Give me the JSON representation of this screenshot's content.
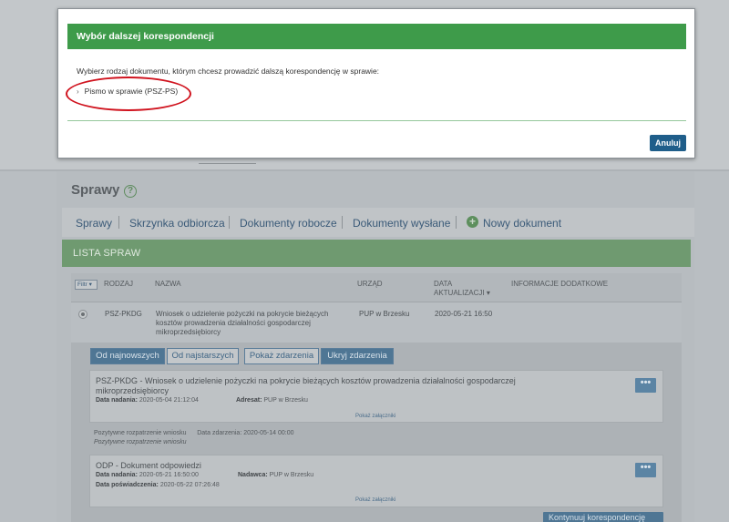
{
  "page": {
    "title": "Sprawy"
  },
  "nav": {
    "items": [
      "Sprawy",
      "Skrzynka odbiorcza",
      "Dokumenty robocze",
      "Dokumenty wysłane"
    ],
    "new_document": "Nowy dokument"
  },
  "lista": {
    "header": "LISTA SPRAW",
    "filter_label": "Filtr",
    "columns": {
      "rodzaj": "RODZAJ",
      "nazwa": "NAZWA",
      "urzad": "URZĄD",
      "data_line1": "DATA",
      "data_line2": "AKTUALIZACJI",
      "info": "INFORMACJE DODATKOWE"
    },
    "row": {
      "rodzaj": "PSZ-PKDG",
      "nazwa": "Wniosek o udzielenie pożyczki na pokrycie bieżących kosztów prowadzenia działalności gospodarczej mikroprzedsiębiorcy",
      "urzad": "PUP w Brzesku",
      "data": "2020-05-21 16:50"
    }
  },
  "events_toolbar": {
    "newest": "Od najnowszych",
    "oldest": "Od najstarszych",
    "show": "Pokaż zdarzenia",
    "hide": "Ukryj zdarzenia"
  },
  "cards": [
    {
      "title": "PSZ-PKDG - Wniosek o udzielenie pożyczki na pokrycie bieżących kosztów prowadzenia działalności gospodarczej mikroprzedsiębiorcy",
      "date_label": "Data nadania:",
      "date_value": "2020-05-04 21:12:04",
      "party_label": "Adresat:",
      "party_value": "PUP w Brzesku",
      "attachments": "Pokaż załączniki",
      "more": "•••"
    },
    {
      "title": "ODP - Dokument odpowiedzi",
      "date_label": "Data nadania:",
      "date_value": "2020-05-21 16:50:00",
      "party_label": "Nadawca:",
      "party_value": "PUP w Brzesku",
      "confirm_label": "Data poświadczenia:",
      "confirm_value": "2020-05-22 07:26:48",
      "attachments": "Pokaż załączniki",
      "more": "•••"
    }
  ],
  "event": {
    "name": "Pozytywne rozpatrzenie wniosku",
    "date_label": "Data zdarzenia:",
    "date_value": "2020-05-14 00:00",
    "detail": "Pozytywne rozpatrzenie wniosku"
  },
  "continue_button": "Kontynuuj korespondencję",
  "modal": {
    "title": "Wybór dalszej korespondencji",
    "text": "Wybierz rodzaj dokumentu, którym chcesz prowadzić dalszą korespondencję w sprawie:",
    "option": "Pismo w sprawie (PSZ-PS)",
    "cancel": "Anuluj"
  },
  "colors": {
    "modal_header": "#3e9b4a",
    "cancel_button": "#1f5e8a",
    "highlight_ellipse": "#d0131e"
  }
}
